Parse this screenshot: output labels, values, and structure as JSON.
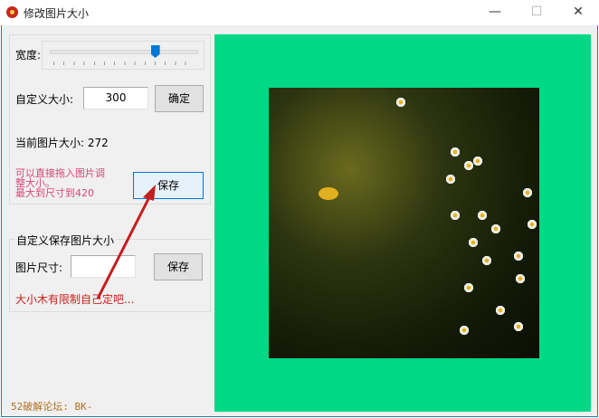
{
  "window": {
    "title": "修改图片大小",
    "minimize": "—",
    "maximize": "☐",
    "close": "✕"
  },
  "width_label": "宽度:",
  "slider": {
    "value_fraction": 0.72
  },
  "custom_size": {
    "label": "自定义大小:",
    "value": "300",
    "confirm": "确定"
  },
  "current_size": "当前图片大小: 272",
  "hint": [
    "可以直接拖入图片调",
    "整大小。",
    "最大到尺寸到420"
  ],
  "save_label": "保存",
  "save_group": {
    "title": "自定义保存图片大小",
    "size_label": "图片尺寸:",
    "size_value": "",
    "save": "保存",
    "note": "大小木有限制自己定吧..."
  },
  "footer": "52破解论坛: BK-",
  "colors": {
    "preview_bg": "#00d886",
    "hint": "#d9457a",
    "note": "#c8201e",
    "footer": "#b07020"
  }
}
